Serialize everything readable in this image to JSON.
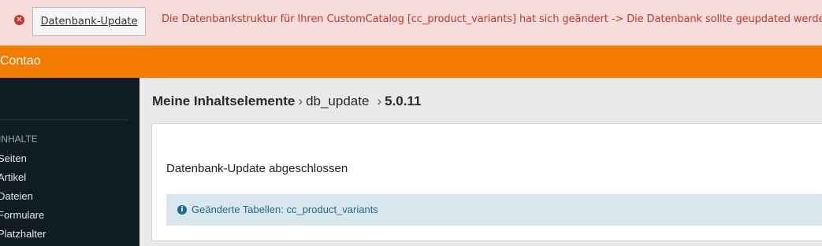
{
  "alert": {
    "icon": "close-circle-icon",
    "button_label": "Datenbank-Update",
    "message": "Die Datenbankstruktur für Ihren CustomCatalog [cc_product_variants] hat sich geändert -> Die Datenbank sollte geupdated werden.",
    "color": "#c0392b",
    "background": "#f8dcdc"
  },
  "topbar": {
    "brand": "Contao",
    "color": "#f47c00"
  },
  "sidebar": {
    "group_label": "INHALTE",
    "items": [
      {
        "label": "Seiten"
      },
      {
        "label": "Artikel"
      },
      {
        "label": "Dateien"
      },
      {
        "label": "Formulare"
      },
      {
        "label": "Platzhalter"
      }
    ]
  },
  "main": {
    "breadcrumb": {
      "part1": "Meine Inhaltselemente",
      "part2": "db_update",
      "part3": "5.0.11",
      "separator": "›"
    },
    "panel_title": "Datenbank-Update abgeschlossen",
    "info": {
      "icon": "info-circle-icon",
      "text": "Geänderte Tabellen: cc_product_variants"
    }
  }
}
